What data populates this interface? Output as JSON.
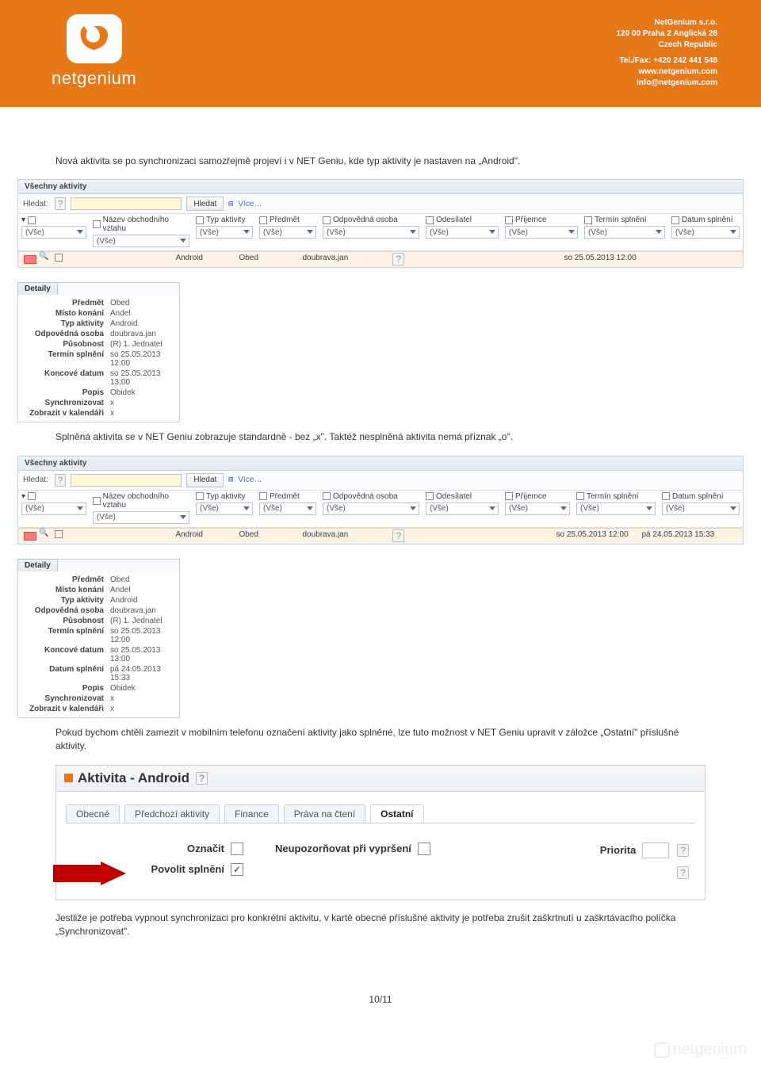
{
  "company": {
    "logo_text": "netgenium",
    "name": "NetGenium s.r.o.",
    "addr1": "120 00 Praha 2 Anglická 28",
    "addr2": "Czech Republic",
    "tel": "Tel./Fax: +420 242 441 548",
    "web": "www.netgenium.com",
    "mail": "info@netgenium.com"
  },
  "intro1": "Nová aktivita se po synchronizaci samozřejmě projeví i v NET Geniu, kde typ aktivity je nastaven na „Android\".",
  "intro2": "Splněná aktivita se v NET Geniu zobrazuje standardně - bez „x\". Taktéž nesplněná aktivita nemá příznak „o\".",
  "intro3": "Pokud bychom chtěli zamezit v mobilním telefonu označení aktivity jako splněné, lze tuto možnost v NET Geniu upravit v záložce „Ostatní\" příslušné aktivity.",
  "intro4": "Jestliže je potřeba vypnout synchronizaci pro konkrétní aktivitu, v kartě obecné příslušné aktivity je potřeba zrušit zaškrtnutí u zaškrtávacího políčka „Synchronizovat\".",
  "grid": {
    "title": "Všechny aktivity",
    "search_label": "Hledat:",
    "search_btn": "Hledat",
    "more": "Více…",
    "vse": "(Vše)",
    "cols": {
      "nazev": "Název obchodního vztahu",
      "typ": "Typ aktivity",
      "predmet": "Předmět",
      "odpov": "Odpovědná osoba",
      "odes": "Odesílatel",
      "prij": "Příjemce",
      "termin": "Termín splnění",
      "datum": "Datum splnění"
    },
    "row": {
      "typ": "Android",
      "predmet": "Obed",
      "odpov": "doubrava.jan",
      "termin": "so 25.05.2013 12:00",
      "datum": "pá 24.05.2013 15:33"
    }
  },
  "details1": [
    {
      "k": "Předmět",
      "v": "Obed"
    },
    {
      "k": "Místo konání",
      "v": "Andel"
    },
    {
      "k": "Typ aktivity",
      "v": "Android"
    },
    {
      "k": "Odpovědná osoba",
      "v": "doubrava.jan"
    },
    {
      "k": "Působnost",
      "v": "(R) 1. Jednatel"
    },
    {
      "k": "Termín splnění",
      "v": "so 25.05.2013 12:00"
    },
    {
      "k": "Koncové datum",
      "v": "so 25.05.2013 13:00"
    },
    {
      "k": "Popis",
      "v": "Obidek"
    },
    {
      "k": "Synchronizovat",
      "v": "x"
    },
    {
      "k": "Zobrazit v kalendáři",
      "v": "x"
    }
  ],
  "details2": [
    {
      "k": "Předmět",
      "v": "Obed"
    },
    {
      "k": "Místo konání",
      "v": "Andel"
    },
    {
      "k": "Typ aktivity",
      "v": "Android"
    },
    {
      "k": "Odpovědná osoba",
      "v": "doubrava.jan"
    },
    {
      "k": "Působnost",
      "v": "(R) 1. Jednatel"
    },
    {
      "k": "Termín splnění",
      "v": "so 25.05.2013 12:00"
    },
    {
      "k": "Koncové datum",
      "v": "so 25.05.2013 13:00"
    },
    {
      "k": "Datum splnění",
      "v": "pá 24.05.2013 15:33"
    },
    {
      "k": "Popis",
      "v": "Obidek"
    },
    {
      "k": "Synchronizovat",
      "v": "x"
    },
    {
      "k": "Zobrazit v kalendáři",
      "v": "x"
    }
  ],
  "activity": {
    "title": "Aktivita - Android",
    "tabs": [
      "Obecné",
      "Předchozí aktivity",
      "Finance",
      "Práva na čtení",
      "Ostatní"
    ],
    "oznacit": "Označit",
    "neupo": "Neupozorňovat při vypršení",
    "priorita": "Priorita",
    "povolit": "Povolit splnění"
  },
  "details_tab": "Detaily",
  "page_no": "10/11"
}
